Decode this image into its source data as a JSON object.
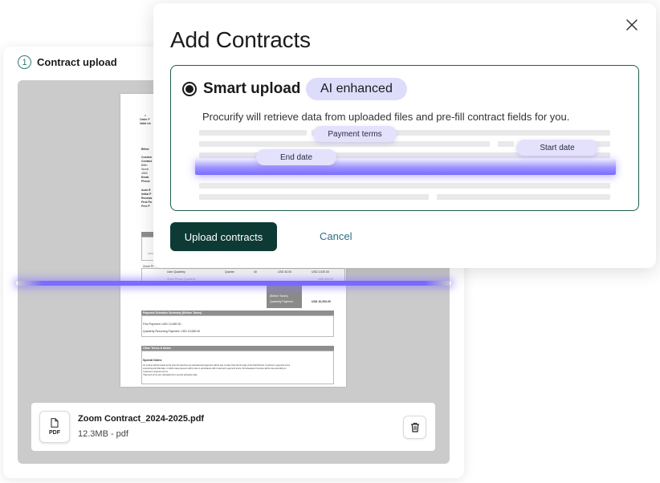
{
  "step": {
    "number": "1",
    "label": "Contract upload"
  },
  "document": {
    "lines": {
      "order": "Order F",
      "valid": "Valid Un",
      "billed": "Billed",
      "customer": "Custom",
      "contact": "Contact",
      "r1": "Billin",
      "r2": "Numb",
      "r3": "4560",
      "r4": "Email",
      "r5": "Phone",
      "auto": "Auto R",
      "initial": "Initial P",
      "renew": "Renewa",
      "first": "First Pa",
      "free": "Free P",
      "zoom_row": "Zoom Pr",
      "item1": "User Quarterly",
      "item1_period": "Quarter",
      "item1_qty": "40",
      "item1_price": "USD 40.00",
      "item1_total": "USD 2,020.00",
      "item2": "Zoom Phone Quarterly",
      "item2_total": "USD 100.00",
      "before_taxes": "(Before Taxes)",
      "quarterly_payment": "Quarterly Payment",
      "grand_total": "USD 10,000.00",
      "payment_header": "Payment Schedule Summary (Before Taxes)",
      "first_payment": "First Payment: USD 10,650.00",
      "quarterly_recurring": "Quarterly Recurring Payment: USD 10,650.00",
      "other_terms": "Other Terms & Notes",
      "special_notes": "Special Notes:",
      "note1": "An invoice will be issued at the time the Services are activated and payment will be due no later than the first day of the Paid Period. Customer's payment terms",
      "note2": "extend beyond that date, in which case payment will be due in accordance with Customer's payment terms. All subsequent invoices will be due according to",
      "note3": "Customer's payment terms.",
      "note4": "*Payment terms are calculated from service activation date."
    }
  },
  "file": {
    "icon_label": "PDF",
    "name": "Zoom Contract_2024-2025.pdf",
    "meta": "12.3MB - pdf"
  },
  "modal": {
    "title": "Add Contracts",
    "option": {
      "title": "Smart upload",
      "badge": "AI enhanced",
      "description": "Procurify will retrieve data from uploaded files and pre-fill contract fields for you.",
      "chips": {
        "payment_terms": "Payment terms",
        "end_date": "End date",
        "start_date": "Start date"
      },
      "selected": true
    },
    "primary_button": "Upload contracts",
    "cancel_button": "Cancel"
  },
  "colors": {
    "primary": "#0e3a36",
    "border_selected": "#1f5b4f",
    "badge_bg": "#dedcfb",
    "glow": "#7a6cff",
    "link": "#2e6f7f"
  },
  "icons": {
    "close": "close-icon",
    "file": "pdf-file-icon",
    "delete": "trash-icon",
    "radio": "radio-selected-icon"
  }
}
